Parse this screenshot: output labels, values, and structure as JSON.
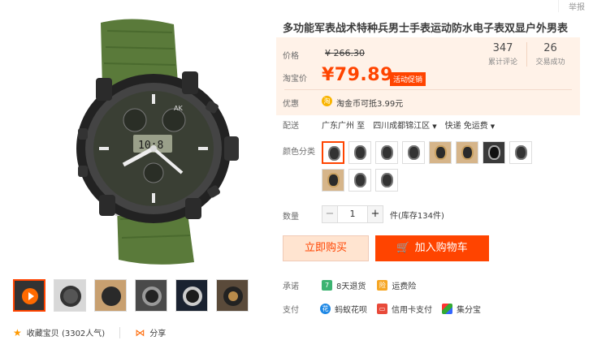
{
  "report": "举报",
  "product": {
    "title": "多功能军表战术特种兵男士手表运动防水电子表双显户外男表"
  },
  "price": {
    "label": "价格",
    "original": "¥ 266.30",
    "promo_label": "淘宝价",
    "promo_price": "¥79.89",
    "promo_tag": "活动促销"
  },
  "stats": [
    {
      "num": "347",
      "label": "累计评论"
    },
    {
      "num": "26",
      "label": "交易成功"
    }
  ],
  "discount": {
    "label": "优惠",
    "coin_text": "淘金币可抵3.99元"
  },
  "shipping": {
    "label": "配送",
    "from": "广东广州 至",
    "to": "四川成都锦江区",
    "method": "快递 免运费"
  },
  "colors": {
    "label": "颜色分类",
    "count": 11,
    "selected": 0
  },
  "quantity": {
    "label": "数量",
    "minus": "−",
    "value": "1",
    "plus": "+",
    "stock": "件(库存134件)"
  },
  "buttons": {
    "buy": "立即购买",
    "cart": "加入购物车"
  },
  "promise": {
    "label": "承诺",
    "items": [
      "8天退货",
      "运费险"
    ]
  },
  "payment": {
    "label": "支付",
    "items": [
      "蚂蚁花呗",
      "信用卡支付",
      "集分宝"
    ]
  },
  "footer": {
    "fav": "收藏宝贝 (3302人气)",
    "share": "分享"
  },
  "icons": {
    "star": "star-icon",
    "share": "share-icon",
    "cart": "cart-icon",
    "coin": "coin-icon"
  },
  "watch_label": "AK",
  "colors_accent": {
    "brand": "#ff4400",
    "price_bg": "#fff2e8",
    "strap": "#5a7a3a"
  }
}
